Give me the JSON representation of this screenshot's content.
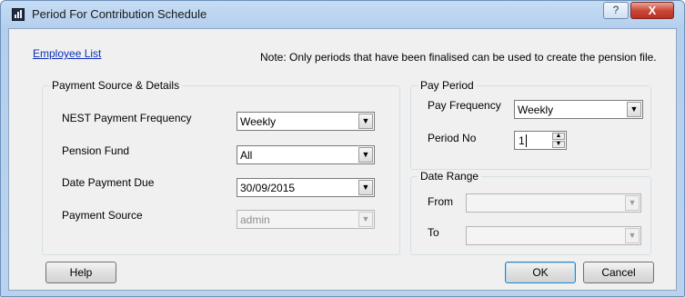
{
  "window": {
    "title": "Period For Contribution Schedule",
    "title_help_label": "?",
    "title_close_label": "X"
  },
  "header": {
    "employee_list_link": "Employee List",
    "note": "Note: Only periods that have been finalised can be used to create the pension file."
  },
  "payment_source": {
    "legend": "Payment Source & Details",
    "nest_payment_frequency": {
      "label": "NEST Payment Frequency",
      "value": "Weekly"
    },
    "pension_fund": {
      "label": "Pension Fund",
      "value": "All"
    },
    "date_payment_due": {
      "label": "Date Payment Due",
      "value": "30/09/2015"
    },
    "payment_source": {
      "label": "Payment Source",
      "value": "admin"
    }
  },
  "pay_period": {
    "legend": "Pay Period",
    "pay_frequency": {
      "label": "Pay Frequency",
      "value": "Weekly"
    },
    "period_no": {
      "label": "Period No",
      "value": "1"
    }
  },
  "date_range": {
    "legend": "Date Range",
    "from": {
      "label": "From",
      "value": ""
    },
    "to": {
      "label": "To",
      "value": ""
    }
  },
  "buttons": {
    "help": "Help",
    "ok": "OK",
    "cancel": "Cancel"
  },
  "icons": {
    "dropdown_arrow": "▼",
    "spin_up": "▲",
    "spin_down": "▼"
  },
  "colors": {
    "title_bar": "#b9d3ef",
    "close_button": "#c9483a",
    "link": "#0b2fb8"
  }
}
